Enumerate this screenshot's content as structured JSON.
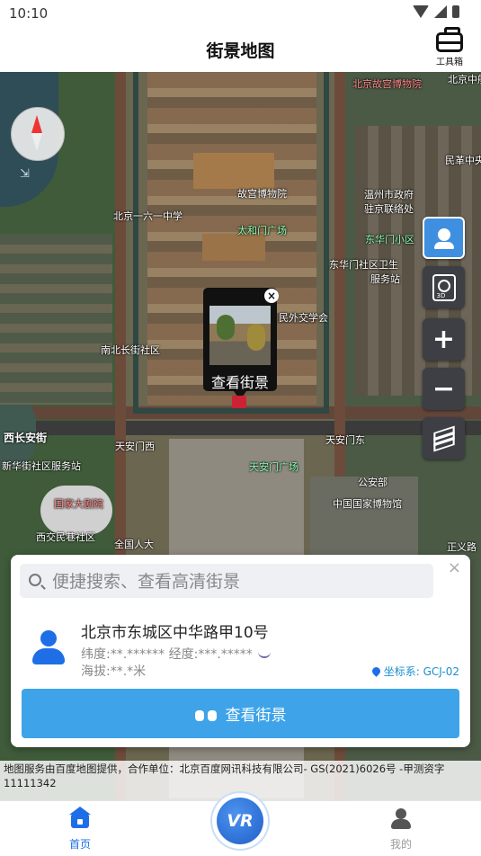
{
  "status_bar": {
    "time": "10:10"
  },
  "header": {
    "title": "街景地图",
    "toolbox_label": "工具箱"
  },
  "map": {
    "labels": [
      "北京故宫博物院",
      "北京一六一中学",
      "故宫博物院",
      "太和门广场",
      "温州市政府",
      "驻京联络处",
      "东华门小区",
      "东华门社区卫生",
      "服务站",
      "民外交学会",
      "南北长街社区",
      "西长安街",
      "天安门西",
      "天安门东",
      "天安门广场",
      "新华街社区服务站",
      "国家大剧院",
      "公安部",
      "中国国家博物馆",
      "全国人大",
      "西交民巷社区",
      "正义路",
      "民革中央",
      "北京中船"
    ],
    "popup": {
      "caption": "查看街景",
      "close": "×"
    }
  },
  "card": {
    "search_placeholder": "便捷搜索、查看高清街景",
    "address": "北京市东城区中华路甲10号",
    "coordinates": "纬度:**.****** 经度:***.*****",
    "altitude": "海拔:**.*米",
    "crs_label": "坐标系:",
    "crs_value": "GCJ-02",
    "button_label": "查看街景",
    "close": "×"
  },
  "copyright": "地图服务由百度地图提供，合作单位：北京百度网讯科技有限公司- GS(2021)6026号 -甲测资字11111342",
  "nav": {
    "home": "首页",
    "me": "我的",
    "vr": "VR"
  },
  "colors": {
    "accent": "#3ea3e8",
    "primary": "#1e6fe6"
  }
}
